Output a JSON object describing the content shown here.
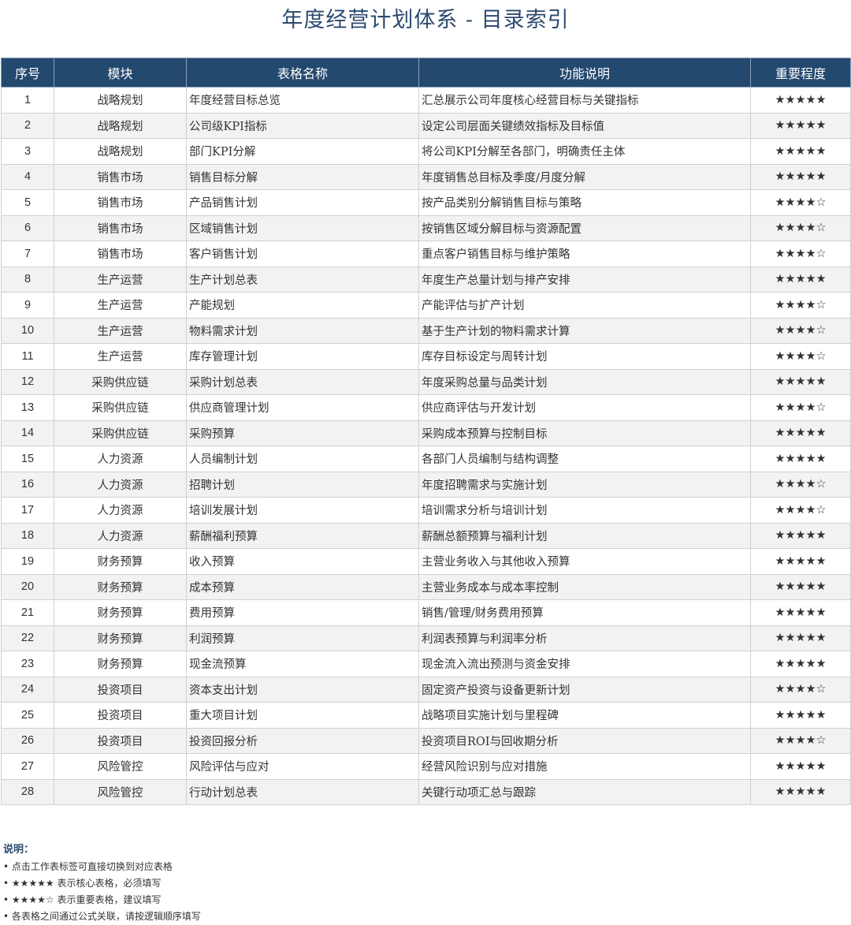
{
  "title": "年度经营计划体系 - 目录索引",
  "columns": [
    "序号",
    "模块",
    "表格名称",
    "功能说明",
    "重要程度"
  ],
  "rows": [
    {
      "no": "1",
      "module": "战略规划",
      "name": "年度经营目标总览",
      "desc": "汇总展示公司年度核心经营目标与关键指标",
      "stars": "★★★★★"
    },
    {
      "no": "2",
      "module": "战略规划",
      "name": "公司级KPI指标",
      "desc": "设定公司层面关键绩效指标及目标值",
      "stars": "★★★★★"
    },
    {
      "no": "3",
      "module": "战略规划",
      "name": "部门KPI分解",
      "desc": "将公司KPI分解至各部门，明确责任主体",
      "stars": "★★★★★"
    },
    {
      "no": "4",
      "module": "销售市场",
      "name": "销售目标分解",
      "desc": "年度销售总目标及季度/月度分解",
      "stars": "★★★★★"
    },
    {
      "no": "5",
      "module": "销售市场",
      "name": "产品销售计划",
      "desc": "按产品类别分解销售目标与策略",
      "stars": "★★★★☆"
    },
    {
      "no": "6",
      "module": "销售市场",
      "name": "区域销售计划",
      "desc": "按销售区域分解目标与资源配置",
      "stars": "★★★★☆"
    },
    {
      "no": "7",
      "module": "销售市场",
      "name": "客户销售计划",
      "desc": "重点客户销售目标与维护策略",
      "stars": "★★★★☆"
    },
    {
      "no": "8",
      "module": "生产运营",
      "name": "生产计划总表",
      "desc": "年度生产总量计划与排产安排",
      "stars": "★★★★★"
    },
    {
      "no": "9",
      "module": "生产运营",
      "name": "产能规划",
      "desc": "产能评估与扩产计划",
      "stars": "★★★★☆"
    },
    {
      "no": "10",
      "module": "生产运营",
      "name": "物料需求计划",
      "desc": "基于生产计划的物料需求计算",
      "stars": "★★★★☆"
    },
    {
      "no": "11",
      "module": "生产运营",
      "name": "库存管理计划",
      "desc": "库存目标设定与周转计划",
      "stars": "★★★★☆"
    },
    {
      "no": "12",
      "module": "采购供应链",
      "name": "采购计划总表",
      "desc": "年度采购总量与品类计划",
      "stars": "★★★★★"
    },
    {
      "no": "13",
      "module": "采购供应链",
      "name": "供应商管理计划",
      "desc": "供应商评估与开发计划",
      "stars": "★★★★☆"
    },
    {
      "no": "14",
      "module": "采购供应链",
      "name": "采购预算",
      "desc": "采购成本预算与控制目标",
      "stars": "★★★★★"
    },
    {
      "no": "15",
      "module": "人力资源",
      "name": "人员编制计划",
      "desc": "各部门人员编制与结构调整",
      "stars": "★★★★★"
    },
    {
      "no": "16",
      "module": "人力资源",
      "name": "招聘计划",
      "desc": "年度招聘需求与实施计划",
      "stars": "★★★★☆"
    },
    {
      "no": "17",
      "module": "人力资源",
      "name": "培训发展计划",
      "desc": "培训需求分析与培训计划",
      "stars": "★★★★☆"
    },
    {
      "no": "18",
      "module": "人力资源",
      "name": "薪酬福利预算",
      "desc": "薪酬总额预算与福利计划",
      "stars": "★★★★★"
    },
    {
      "no": "19",
      "module": "财务预算",
      "name": "收入预算",
      "desc": "主营业务收入与其他收入预算",
      "stars": "★★★★★"
    },
    {
      "no": "20",
      "module": "财务预算",
      "name": "成本预算",
      "desc": "主营业务成本与成本率控制",
      "stars": "★★★★★"
    },
    {
      "no": "21",
      "module": "财务预算",
      "name": "费用预算",
      "desc": "销售/管理/财务费用预算",
      "stars": "★★★★★"
    },
    {
      "no": "22",
      "module": "财务预算",
      "name": "利润预算",
      "desc": "利润表预算与利润率分析",
      "stars": "★★★★★"
    },
    {
      "no": "23",
      "module": "财务预算",
      "name": "现金流预算",
      "desc": "现金流入流出预测与资金安排",
      "stars": "★★★★★"
    },
    {
      "no": "24",
      "module": "投资项目",
      "name": "资本支出计划",
      "desc": "固定资产投资与设备更新计划",
      "stars": "★★★★☆"
    },
    {
      "no": "25",
      "module": "投资项目",
      "name": "重大项目计划",
      "desc": "战略项目实施计划与里程碑",
      "stars": "★★★★★"
    },
    {
      "no": "26",
      "module": "投资项目",
      "name": "投资回报分析",
      "desc": "投资项目ROI与回收期分析",
      "stars": "★★★★☆"
    },
    {
      "no": "27",
      "module": "风险管控",
      "name": "风险评估与应对",
      "desc": "经营风险识别与应对措施",
      "stars": "★★★★★"
    },
    {
      "no": "28",
      "module": "风险管控",
      "name": "行动计划总表",
      "desc": "关键行动项汇总与跟踪",
      "stars": "★★★★★"
    }
  ],
  "notes": {
    "title": "说明：",
    "lines": [
      "• 点击工作表标签可直接切换到对应表格",
      "• ★★★★★ 表示核心表格，必须填写",
      "• ★★★★☆ 表示重要表格，建议填写",
      "• 各表格之间通过公式关联，请按逻辑顺序填写"
    ]
  },
  "colors": {
    "header_bg": "#24496f",
    "title": "#2c4a6e",
    "stripe": "#f2f2f2"
  }
}
